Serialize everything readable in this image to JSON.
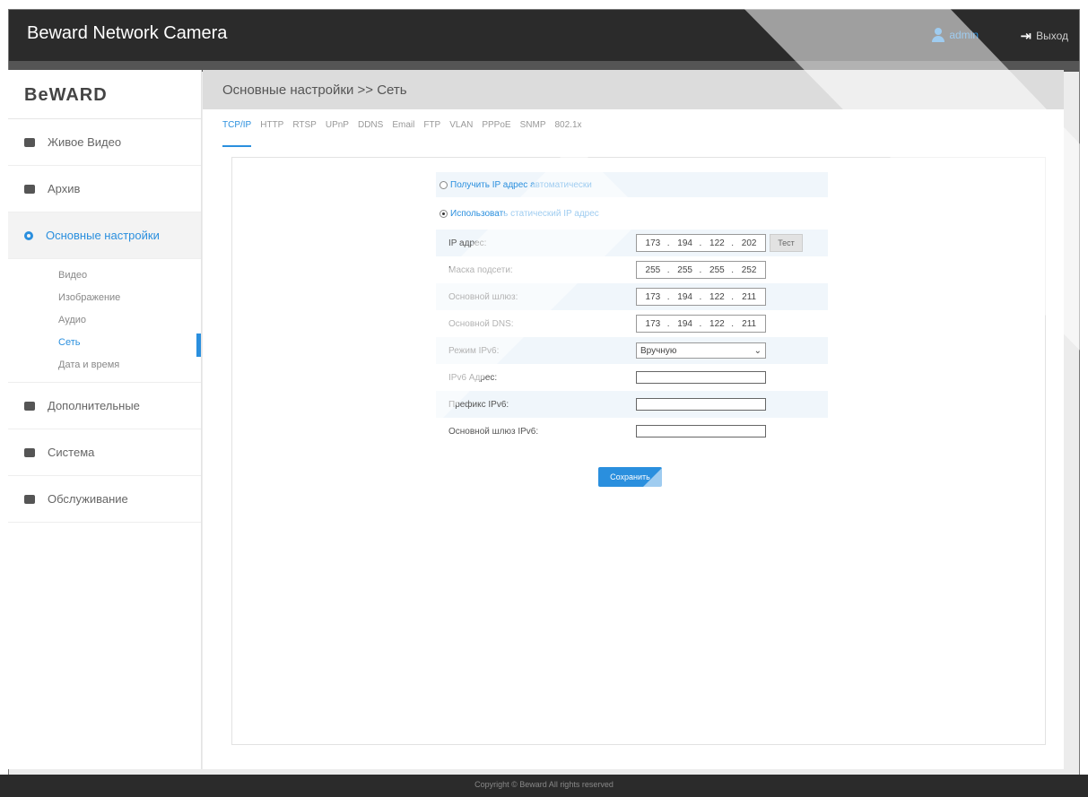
{
  "app": {
    "title": "Beward Network Camera"
  },
  "header": {
    "user": "admin",
    "logout": "Выход"
  },
  "sidebar": {
    "logo": "BeWARD",
    "items": [
      {
        "label": "Живое Видео"
      },
      {
        "label": "Архив"
      },
      {
        "label": "Основные настройки"
      },
      {
        "label": "Дополнительные"
      },
      {
        "label": "Система"
      },
      {
        "label": "Обслуживание"
      }
    ],
    "subitems": [
      {
        "label": "Видео"
      },
      {
        "label": "Изображение"
      },
      {
        "label": "Аудио"
      },
      {
        "label": "Сеть"
      },
      {
        "label": "Дата и время"
      }
    ]
  },
  "main": {
    "breadcrumb": "Основные настройки >> Сеть",
    "tabs": [
      "TCP/IP",
      "HTTP",
      "RTSP",
      "UPnP",
      "DDNS",
      "Email",
      "FTP",
      "VLAN",
      "PPPoE",
      "SNMP",
      "802.1x"
    ],
    "radio_auto": "Получить IP адрес автоматически",
    "radio_static": "Использовать статический IP адрес",
    "fields": {
      "ip": {
        "label": "IP адрес:",
        "value": [
          "173",
          "194",
          "122",
          "202"
        ],
        "test": "Тест"
      },
      "mask": {
        "label": "Маска подсети:",
        "value": [
          "255",
          "255",
          "255",
          "252"
        ]
      },
      "gateway": {
        "label": "Основной шлюз:",
        "value": [
          "173",
          "194",
          "122",
          "211"
        ]
      },
      "dns": {
        "label": "Основной DNS:",
        "value": [
          "173",
          "194",
          "122",
          "211"
        ]
      },
      "ipv6_mode": {
        "label": "Режим IPv6:",
        "value": "Вручную"
      },
      "ipv6_addr": {
        "label": "IPv6 Адрес:",
        "value": ""
      },
      "ipv6_prefix": {
        "label": "Префикс IPv6:",
        "value": ""
      },
      "ipv6_gateway": {
        "label": "Основной шлюз IPv6:",
        "value": ""
      }
    },
    "save": "Сохранить"
  },
  "footer": {
    "copyright": "Copyright © Beward All rights reserved"
  },
  "colors": {
    "accent": "#2a8fde",
    "topbar": "#2b2b2b"
  }
}
